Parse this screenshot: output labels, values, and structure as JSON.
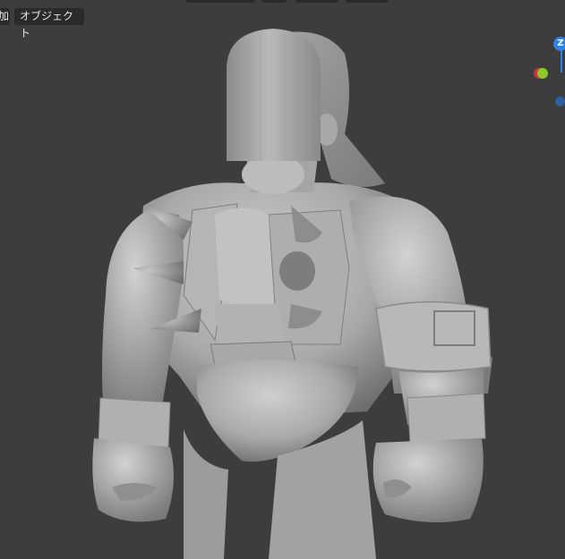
{
  "header": {
    "add_menu_label": "加",
    "object_menu_label": "オブジェクト"
  },
  "gizmo": {
    "z_label": "Z",
    "colors": {
      "x": "#c93245",
      "y": "#8ac926",
      "z": "#2f83e6"
    }
  },
  "viewport": {
    "background": "#3d3d3d",
    "model_description_icon": "character-sculpt-icon"
  }
}
